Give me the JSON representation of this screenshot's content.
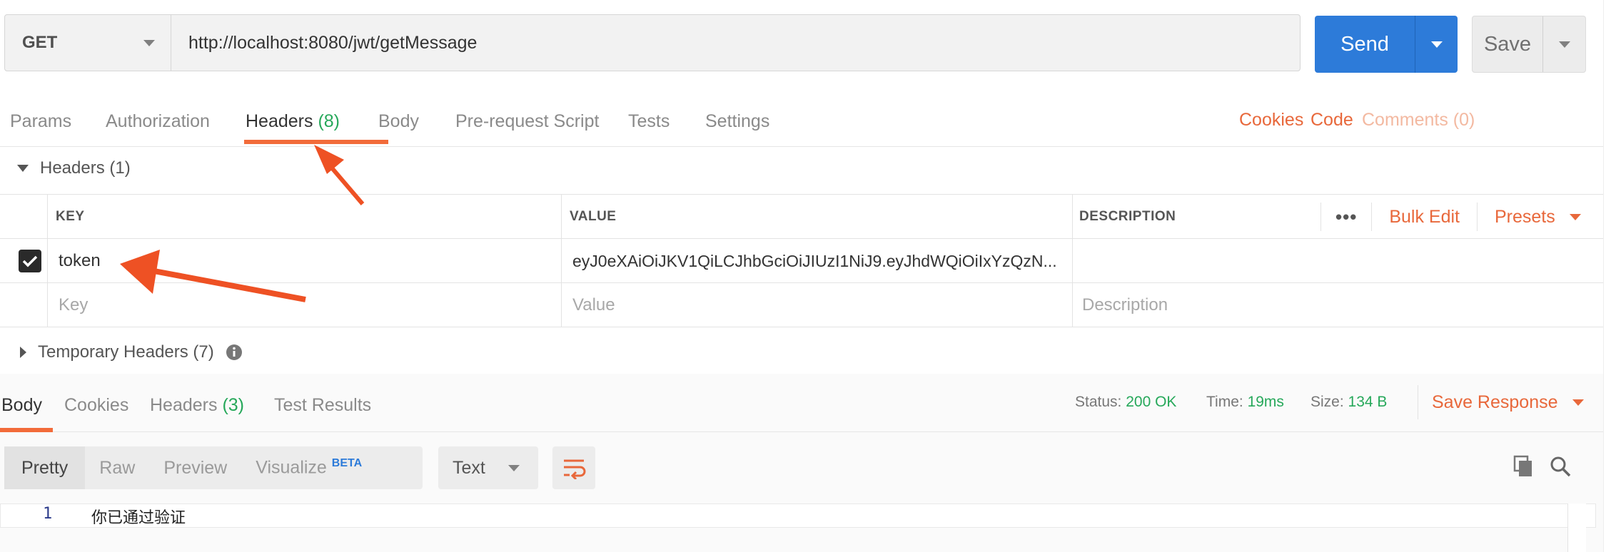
{
  "request": {
    "method": "GET",
    "url": "http://localhost:8080/jwt/getMessage",
    "send_label": "Send",
    "save_label": "Save"
  },
  "request_tabs": [
    {
      "label": "Params",
      "count": ""
    },
    {
      "label": "Authorization",
      "count": ""
    },
    {
      "label": "Headers",
      "count": "(8)"
    },
    {
      "label": "Body",
      "count": ""
    },
    {
      "label": "Pre-request Script",
      "count": ""
    },
    {
      "label": "Tests",
      "count": ""
    },
    {
      "label": "Settings",
      "count": ""
    }
  ],
  "right_links": {
    "cookies": "Cookies",
    "code": "Code",
    "comments": "Comments (0)"
  },
  "headers_section": {
    "title": "Headers",
    "count": "(1)",
    "columns": {
      "key": "KEY",
      "value": "VALUE",
      "description": "DESCRIPTION"
    },
    "bulk_edit": "Bulk Edit",
    "presets": "Presets",
    "rows": [
      {
        "key": "token",
        "value": "eyJ0eXAiOiJKV1QiLCJhbGciOiJIUzI1NiJ9.eyJhdWQiOiIxYzQzN...",
        "description": "",
        "checked": true
      }
    ],
    "placeholder": {
      "key": "Key",
      "value": "Value",
      "description": "Description"
    }
  },
  "temporary_headers": {
    "title": "Temporary Headers",
    "count": "(7)"
  },
  "response_tabs": [
    {
      "label": "Body",
      "count": ""
    },
    {
      "label": "Cookies",
      "count": ""
    },
    {
      "label": "Headers",
      "count": "(3)"
    },
    {
      "label": "Test Results",
      "count": ""
    }
  ],
  "response_status": {
    "status_label": "Status:",
    "status_value": "200 OK",
    "time_label": "Time:",
    "time_value": "19ms",
    "size_label": "Size:",
    "size_value": "134 B",
    "save_response": "Save Response"
  },
  "view_modes": {
    "pretty": "Pretty",
    "raw": "Raw",
    "preview": "Preview",
    "visualize": "Visualize",
    "beta": "BETA"
  },
  "format": "Text",
  "body_lines": [
    {
      "number": "1",
      "text": "你已通过验证"
    }
  ],
  "colors": {
    "accent_orange": "#e8683b",
    "send_blue": "#2d7bd9",
    "count_green": "#26a85a",
    "annotation_arrow": "#ee5124"
  }
}
